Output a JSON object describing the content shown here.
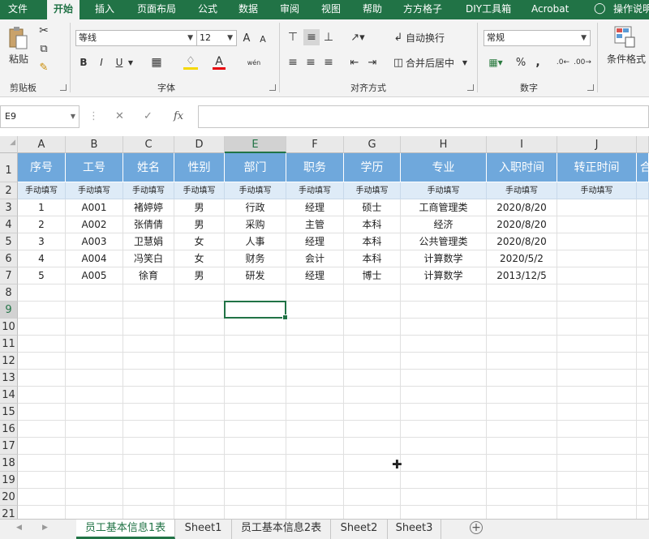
{
  "ribbon_tabs": [
    "文件",
    "开始",
    "插入",
    "页面布局",
    "公式",
    "数据",
    "审阅",
    "视图",
    "帮助",
    "方方格子",
    "DIY工具箱",
    "Acrobat",
    "操作说明"
  ],
  "active_tab": "开始",
  "clipboard": {
    "paste": "粘贴",
    "label": "剪贴板"
  },
  "font": {
    "name": "等线",
    "size": "12",
    "label": "字体",
    "bold": "B",
    "italic": "I",
    "underline": "U",
    "grow": "A",
    "shrink": "A",
    "font_color": "A",
    "phonetic": "wén"
  },
  "alignment": {
    "wrap": "自动换行",
    "merge": "合并后居中",
    "label": "对齐方式"
  },
  "number": {
    "format": "常规",
    "label": "数字",
    "percent": "%",
    "comma": ","
  },
  "styles": {
    "conditional": "条件格式"
  },
  "formula_bar": {
    "name_box": "E9",
    "fx": "fx",
    "value": ""
  },
  "colors": {
    "accent": "#217346",
    "header_fill": "#6fa8dc",
    "subheader_fill": "#deebf7"
  },
  "columns": [
    "A",
    "B",
    "C",
    "D",
    "E",
    "F",
    "G",
    "H",
    "I",
    "J"
  ],
  "rows": [
    "1",
    "2",
    "3",
    "4",
    "5",
    "6",
    "7",
    "8",
    "9",
    "10",
    "11",
    "12",
    "13",
    "14",
    "15",
    "16",
    "17",
    "18",
    "19",
    "20",
    "21"
  ],
  "headers": [
    "序号",
    "工号",
    "姓名",
    "性别",
    "部门",
    "职务",
    "学历",
    "专业",
    "入职时间",
    "转正时间",
    "合"
  ],
  "subheaders": [
    "手动填写",
    "手动填写",
    "手动填写",
    "手动填写",
    "手动填写",
    "手动填写",
    "手动填写",
    "手动填写",
    "手动填写",
    "手动填写"
  ],
  "data_rows": [
    [
      "1",
      "A001",
      "褚婷婷",
      "男",
      "行政",
      "经理",
      "硕士",
      "工商管理类",
      "2020/8/20",
      ""
    ],
    [
      "2",
      "A002",
      "张倩倩",
      "男",
      "采购",
      "主管",
      "本科",
      "经济",
      "2020/8/20",
      ""
    ],
    [
      "3",
      "A003",
      "卫慧娟",
      "女",
      "人事",
      "经理",
      "本科",
      "公共管理类",
      "2020/8/20",
      ""
    ],
    [
      "4",
      "A004",
      "冯笑白",
      "女",
      "财务",
      "会计",
      "本科",
      "计算数学",
      "2020/5/2",
      ""
    ],
    [
      "5",
      "A005",
      "徐育",
      "男",
      "研发",
      "经理",
      "博士",
      "计算数学",
      "2013/12/5",
      ""
    ]
  ],
  "sheets": [
    "员工基本信息1表",
    "Sheet1",
    "员工基本信息2表",
    "Sheet2",
    "Sheet3"
  ],
  "active_sheet": "员工基本信息1表"
}
